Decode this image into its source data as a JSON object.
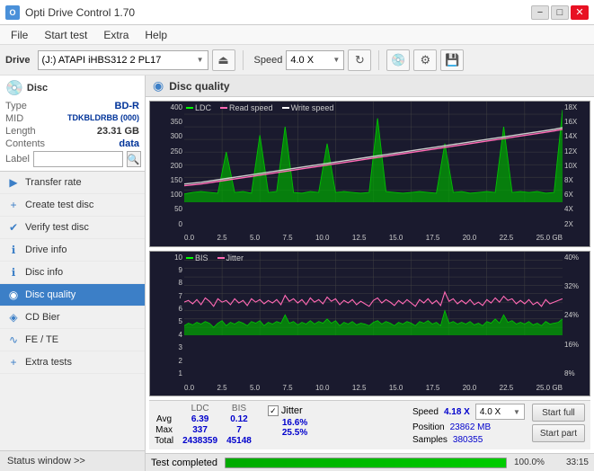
{
  "window": {
    "title": "Opti Drive Control 1.70",
    "icon_label": "O"
  },
  "titlebar": {
    "minimize": "−",
    "maximize": "□",
    "close": "✕"
  },
  "menubar": {
    "items": [
      "File",
      "Start test",
      "Extra",
      "Help"
    ]
  },
  "toolbar": {
    "drive_label": "Drive",
    "drive_value": "(J:)  ATAPI iHBS312  2 PL17",
    "speed_label": "Speed",
    "speed_value": "4.0 X",
    "eject_icon": "⏏",
    "refresh_icon": "↻",
    "disc_icon": "💿",
    "config_icon": "⚙",
    "save_icon": "💾"
  },
  "sidebar": {
    "disc": {
      "type_label": "Type",
      "type_value": "BD-R",
      "mid_label": "MID",
      "mid_value": "TDKBLDRBB (000)",
      "length_label": "Length",
      "length_value": "23.31 GB",
      "contents_label": "Contents",
      "contents_value": "data",
      "label_label": "Label",
      "label_placeholder": ""
    },
    "nav": [
      {
        "id": "transfer-rate",
        "label": "Transfer rate",
        "icon": "▶"
      },
      {
        "id": "create-test-disc",
        "label": "Create test disc",
        "icon": "+"
      },
      {
        "id": "verify-test-disc",
        "label": "Verify test disc",
        "icon": "✔"
      },
      {
        "id": "drive-info",
        "label": "Drive info",
        "icon": "ℹ"
      },
      {
        "id": "disc-info",
        "label": "Disc info",
        "icon": "ℹ"
      },
      {
        "id": "disc-quality",
        "label": "Disc quality",
        "icon": "◉",
        "active": true
      },
      {
        "id": "cd-bier",
        "label": "CD Bier",
        "icon": "◈"
      },
      {
        "id": "fe-te",
        "label": "FE / TE",
        "icon": "~"
      },
      {
        "id": "extra-tests",
        "label": "Extra tests",
        "icon": "+"
      }
    ],
    "status_window": "Status window >>",
    "status_text": "Test completed"
  },
  "chart": {
    "title": "Disc quality",
    "icon": "◉",
    "upper": {
      "legend": [
        {
          "label": "LDC",
          "color": "#00ff00"
        },
        {
          "label": "Read speed",
          "color": "#ff69b4"
        },
        {
          "label": "Write speed",
          "color": "#ffffff"
        }
      ],
      "y_axis_left": [
        "400",
        "350",
        "300",
        "250",
        "200",
        "150",
        "100",
        "50",
        "0"
      ],
      "y_axis_right": [
        "18X",
        "16X",
        "14X",
        "12X",
        "10X",
        "8X",
        "6X",
        "4X",
        "2X"
      ],
      "x_axis": [
        "0.0",
        "2.5",
        "5.0",
        "7.5",
        "10.0",
        "12.5",
        "15.0",
        "17.5",
        "20.0",
        "22.5",
        "25.0 GB"
      ]
    },
    "lower": {
      "legend": [
        {
          "label": "BIS",
          "color": "#00ff00"
        },
        {
          "label": "Jitter",
          "color": "#ff69b4"
        }
      ],
      "y_axis_left": [
        "10",
        "9",
        "8",
        "7",
        "6",
        "5",
        "4",
        "3",
        "2",
        "1"
      ],
      "y_axis_right": [
        "40%",
        "32%",
        "24%",
        "16%",
        "8%"
      ],
      "x_axis": [
        "0.0",
        "2.5",
        "5.0",
        "7.5",
        "10.0",
        "12.5",
        "15.0",
        "17.5",
        "20.0",
        "22.5",
        "25.0 GB"
      ]
    }
  },
  "stats": {
    "headers": [
      "",
      "LDC",
      "BIS"
    ],
    "avg_label": "Avg",
    "avg_ldc": "6.39",
    "avg_bis": "0.12",
    "max_label": "Max",
    "max_ldc": "337",
    "max_bis": "7",
    "total_label": "Total",
    "total_ldc": "2438359",
    "total_bis": "45148",
    "jitter_label": "Jitter",
    "jitter_checked": true,
    "jitter_avg": "16.6%",
    "jitter_max": "25.5%",
    "speed_label": "Speed",
    "speed_value": "4.18 X",
    "speed_select": "4.0 X",
    "position_label": "Position",
    "position_value": "23862 MB",
    "samples_label": "Samples",
    "samples_value": "380355",
    "btn_start_full": "Start full",
    "btn_start_part": "Start part"
  },
  "progress": {
    "percentage": "100.0%",
    "fill_width": "100",
    "time": "33:15"
  }
}
